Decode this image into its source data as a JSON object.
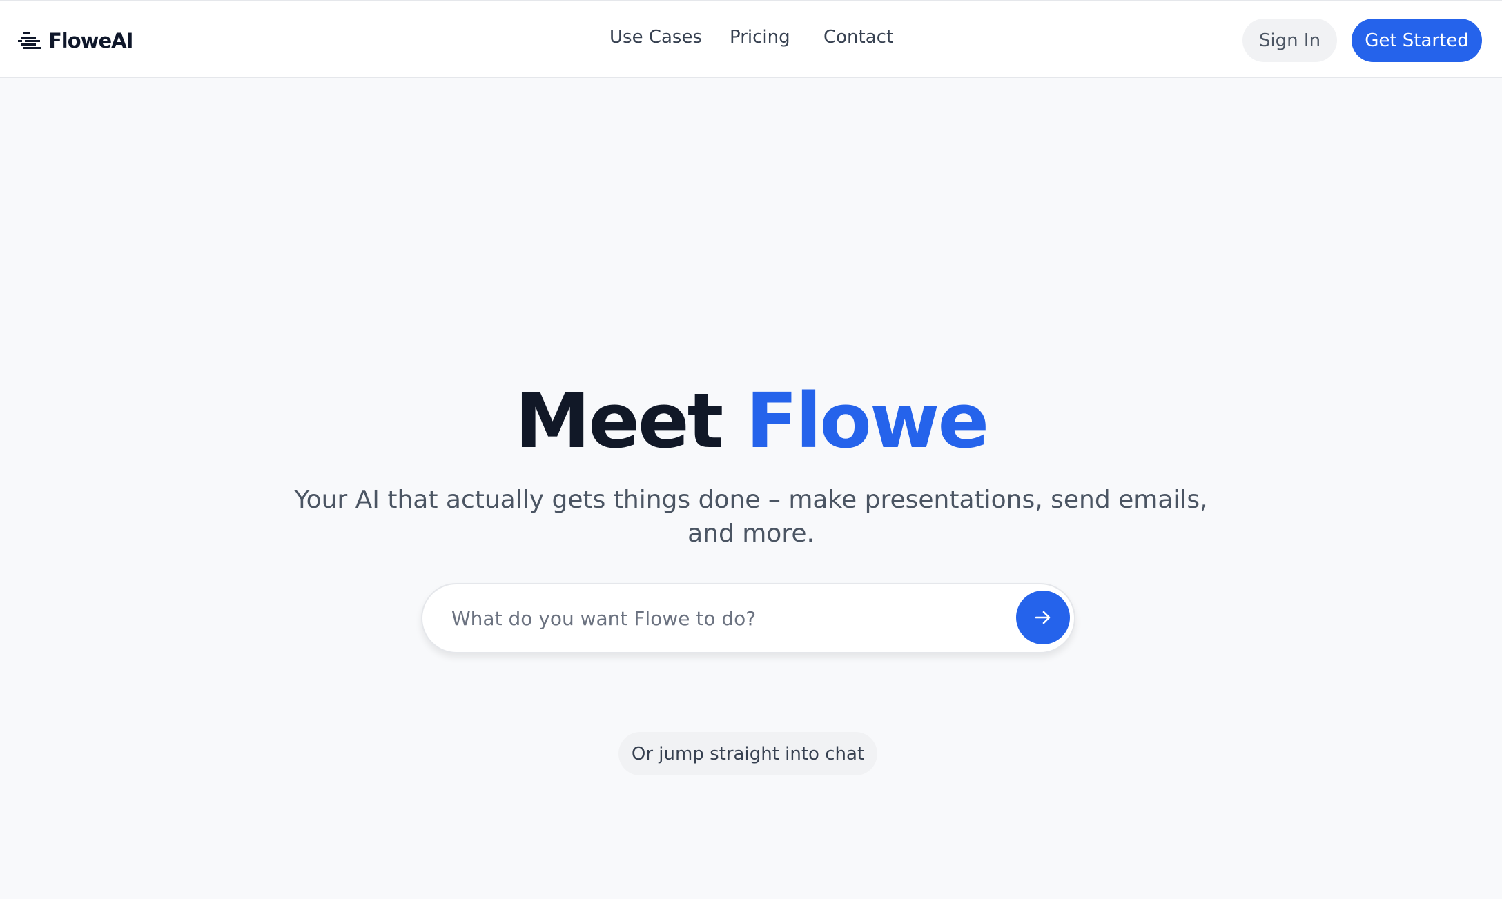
{
  "brand": {
    "name": "FloweAI",
    "logo_icon": "stacked-lines-icon"
  },
  "nav": {
    "items": [
      {
        "label": "Use Cases"
      },
      {
        "label": "Pricing"
      },
      {
        "label": "Contact"
      }
    ]
  },
  "auth": {
    "sign_in_label": "Sign In",
    "get_started_label": "Get Started"
  },
  "hero": {
    "title_prefix": "Meet ",
    "title_accent": "Flowe",
    "subtitle_line1": "Your AI that actually gets things done – make presentations, send emails,",
    "subtitle_line2": "and more."
  },
  "prompt": {
    "placeholder": "What do you want Flowe to do?",
    "value": "",
    "submit_icon": "arrow-right-icon"
  },
  "chat_link": {
    "label": "Or jump straight into chat"
  },
  "colors": {
    "accent": "#2563eb",
    "heading": "#111827",
    "body_text": "#4b5563",
    "page_background": "#f8f9fb",
    "pill_background": "#f1f2f4"
  }
}
